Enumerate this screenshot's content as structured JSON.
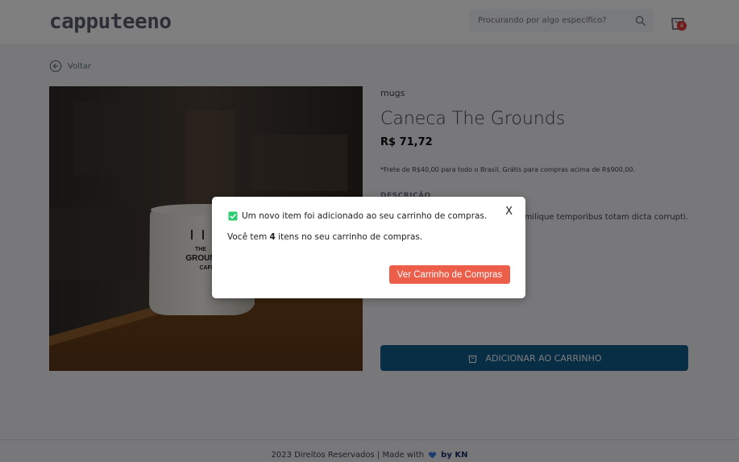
{
  "header": {
    "logo": "capputeeno",
    "search_placeholder": "Procurando por algo específico?",
    "cart_count": "4"
  },
  "back": {
    "label": "Voltar"
  },
  "product": {
    "category": "mugs",
    "name": "Caneca The Grounds",
    "price": "R$ 71,72",
    "shipping": "*Frete de R$40,00 para todo o Brasil. Grátis para compras acima de R$900,00.",
    "description_title": "DESCRIÇÃO",
    "description_text": "m nesciunt similique temporibus totam dicta corrupti.",
    "add_to_cart": "ADICIONAR AO CARRINHO",
    "image_mug_text_1": "THE",
    "image_mug_text_2": "GROUN",
    "image_mug_text_3": "CAFÉ"
  },
  "footer": {
    "text": "2023 Direitos Reservados | Made with",
    "by": "by KN"
  },
  "modal": {
    "message": "Um novo item foi adicionado ao seu carrinho de compras.",
    "count_prefix": "Você tem",
    "count_value": "4",
    "count_suffix": "itens no seu carrinho de compras.",
    "close": "X",
    "button": "Ver Carrinho de Compras"
  },
  "colors": {
    "accent_blue": "#115d8c",
    "button_red": "#ec5e4a",
    "badge_red": "#de3838",
    "check_green": "#2ecc71"
  },
  "icons": [
    "search-icon",
    "shopping-bag-icon",
    "back-arrow-icon",
    "heart-icon",
    "checkbox-icon"
  ]
}
